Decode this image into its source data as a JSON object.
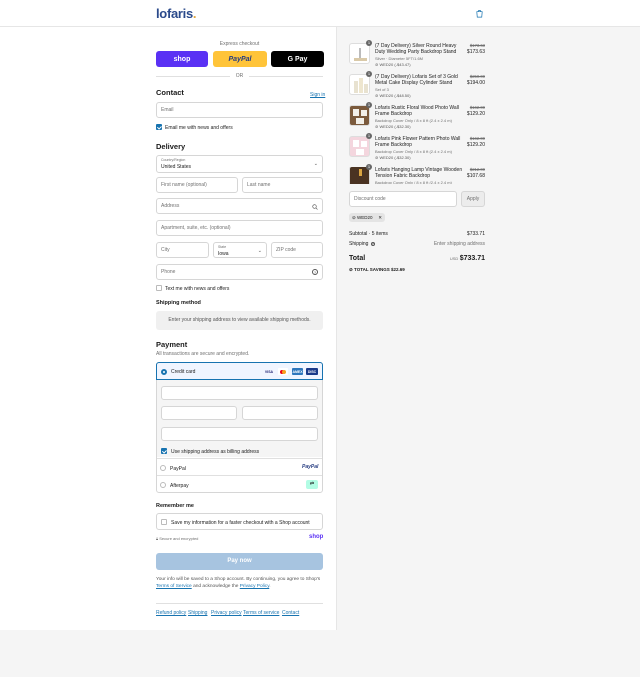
{
  "brand": {
    "logo": "lofaris",
    "logo_dot": "."
  },
  "express": {
    "label": "Express checkout",
    "shop": "shop",
    "paypal": "PayPal",
    "gpay": "G Pay",
    "or": "OR"
  },
  "contact": {
    "title": "Contact",
    "signin": "Sign in",
    "email_placeholder": "Email",
    "news_label": "Email me with news and offers",
    "news_checked": true
  },
  "delivery": {
    "title": "Delivery",
    "country_label": "Country/Region",
    "country_value": "United States",
    "first_name": "First name (optional)",
    "last_name": "Last name",
    "address": "Address",
    "apartment": "Apartment, suite, etc. (optional)",
    "city": "City",
    "state_label": "State",
    "state_value": "Iowa",
    "zip": "ZIP code",
    "phone": "Phone",
    "text_label": "Text me with news and offers"
  },
  "shipping": {
    "title": "Shipping method",
    "message": "Enter your shipping address to view available shipping methods."
  },
  "payment": {
    "title": "Payment",
    "subtitle": "All transactions are secure and encrypted.",
    "credit_card": "Credit card",
    "cards": [
      "VISA",
      "MC",
      "AMEX",
      "DISC"
    ],
    "billing_label": "Use shipping address as billing address",
    "paypal": "PayPal",
    "paypal_logo": "PayPal",
    "afterpay": "Afterpay",
    "afterpay_logo": "⇄"
  },
  "remember": {
    "title": "Remember me",
    "save_label": "Save my information for a faster checkout with a Shop account",
    "secure": "Secure and encrypted",
    "shop_logo": "shop"
  },
  "paynow": "Pay now",
  "legal": {
    "text1": "Your info will be saved to a Shop account. By continuing, you agree to Shop's",
    "terms": "Terms of Service",
    "text2": "and acknowledge the",
    "privacy": "Privacy Policy",
    "end": "."
  },
  "footer": [
    "Refund policy",
    "Shipping",
    "Privacy policy",
    "Terms of service",
    "Contact"
  ],
  "cart": {
    "items": [
      {
        "qty": "1",
        "name": "(7 Day Delivery) Silver Round Heavy Duty Wedding Party Backdrop Stand",
        "variant": "Silver · Diameter 5FT/1.6M",
        "discount": "WED20 (-$43.47)",
        "old_price": "$173.63",
        "price": "$173.63"
      },
      {
        "qty": "1",
        "name": "(7 Day Delivery) Lofaris Set of 3 Gold Metal Cake Display Cylinder Stand",
        "variant": "Set of 3",
        "discount": "WED20 (-$48.50)",
        "old_price": "$250.00",
        "price": "$194.00"
      },
      {
        "qty": "1",
        "name": "Lofaris Rustic Floral Wood Photo Wall Frame Backdrop",
        "variant": "Backdrop Cover Only / 8 x 8 ft (2.4 x 2.4 m)",
        "discount": "WED20 (-$32.30)",
        "old_price": "$162.00",
        "price": "$129.20"
      },
      {
        "qty": "1",
        "name": "Lofaris Pink Flower Pattern Photo Wall Frame Backdrop",
        "variant": "Backdrop Cover Only / 8 x 8 ft (2.4 x 2.4 m)",
        "discount": "WED20 (-$32.30)",
        "old_price": "$162.00",
        "price": "$129.20"
      },
      {
        "qty": "1",
        "name": "Lofaris Hanging Lamp Vintage Wooden Tension Fabric Backdrop",
        "variant": "Backdrop Cover Only / 8 x 8 ft (2.4 x 2.4 m)",
        "discount": "",
        "old_price": "$212.00",
        "price": "$107.68"
      }
    ],
    "discount_placeholder": "Discount code",
    "apply": "Apply",
    "chip": "WED20",
    "subtotal_label": "Subtotal · 5 items",
    "subtotal": "$733.71",
    "shipping_label": "Shipping",
    "shipping_value": "Enter shipping address",
    "total_label": "Total",
    "currency": "USD",
    "total": "$733.71",
    "savings_label": "TOTAL SAVINGS",
    "savings": "$22.69"
  }
}
